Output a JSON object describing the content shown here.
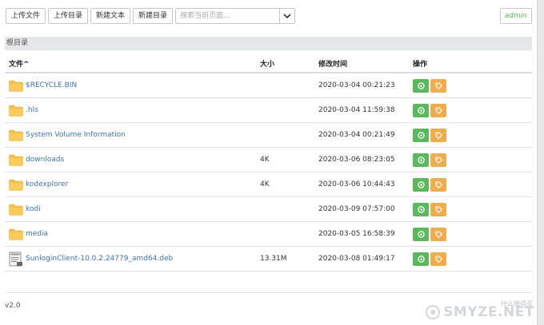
{
  "toolbar": {
    "upload_file": "上传文件",
    "upload_dir": "上传目录",
    "new_text": "新建文本",
    "new_dir": "新建目录",
    "search_placeholder": "搜索当前页面..."
  },
  "user": "admin",
  "breadcrumb": "根目录",
  "table": {
    "headers": {
      "name": "文件^",
      "size": "大小",
      "mtime": "修改时间",
      "actions": "操作"
    },
    "rows": [
      {
        "type": "folder",
        "name": "$RECYCLE.BIN",
        "size": "",
        "mtime": "2020-03-04 00:21:23"
      },
      {
        "type": "folder",
        "name": ".hls",
        "size": "",
        "mtime": "2020-03-04 11:59:38"
      },
      {
        "type": "folder",
        "name": "System Volume Information",
        "size": "",
        "mtime": "2020-03-04 00:21:49"
      },
      {
        "type": "folder",
        "name": "downloads",
        "size": "4K",
        "mtime": "2020-03-06 08:23:05"
      },
      {
        "type": "folder",
        "name": "kodexplorer",
        "size": "4K",
        "mtime": "2020-03-06 10:44:43"
      },
      {
        "type": "folder",
        "name": "kodi",
        "size": "",
        "mtime": "2020-03-09 07:57:00"
      },
      {
        "type": "folder",
        "name": "media",
        "size": "",
        "mtime": "2020-03-05 16:58:39"
      },
      {
        "type": "file",
        "name": "SunloginClient-10.0.2.24779_amd64.deb",
        "size": "13.31M",
        "mtime": "2020-03-08 01:49:17"
      }
    ]
  },
  "footer": {
    "version": "v2.0"
  },
  "watermark": {
    "text": "SMYZE.NET",
    "small": "什么值得买"
  },
  "colors": {
    "green": "#5cb85c",
    "orange": "#f0ad4e",
    "link": "#3f73b0",
    "folder": "#f7c04a"
  }
}
